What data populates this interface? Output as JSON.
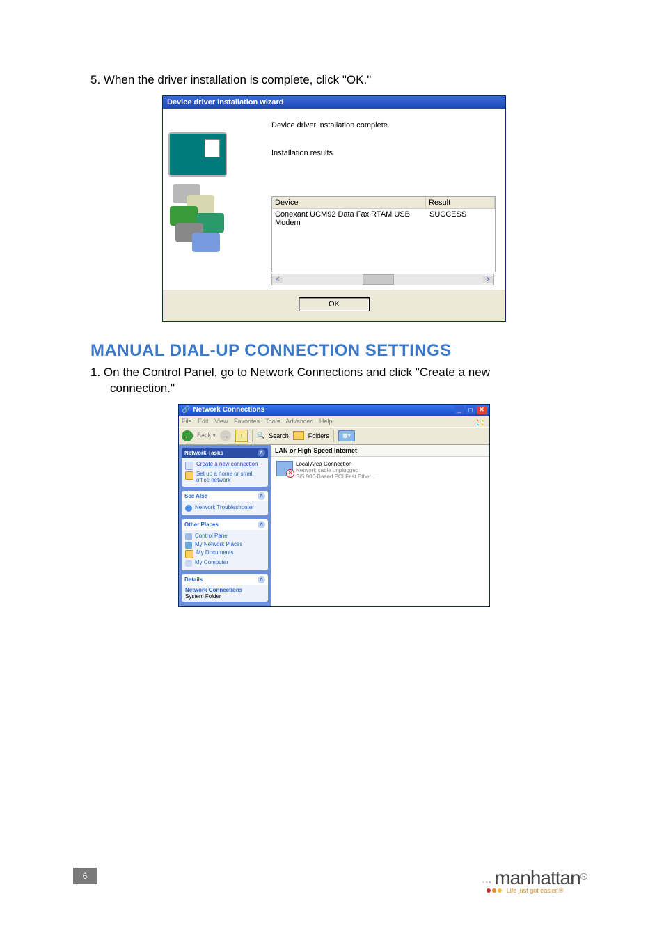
{
  "step5": {
    "num": "5.",
    "text": "When the driver installation is complete, click \"OK.\""
  },
  "wizard": {
    "title": "Device driver installation wizard",
    "line1": "Device driver installation complete.",
    "line2": "Installation results.",
    "col_device": "Device",
    "col_result": "Result",
    "row_device": "Conexant UCM92 Data Fax RTAM USB Modem",
    "row_result": "SUCCESS",
    "ok": "OK"
  },
  "section_heading": "MANUAL DIAL-UP CONNECTION SETTINGS",
  "step1": {
    "num": "1.",
    "text_a": "On the Control Panel, go to Network Connections and click \"Create a new",
    "text_b": "connection.\""
  },
  "xp": {
    "title": "Network Connections",
    "menu": {
      "file": "File",
      "edit": "Edit",
      "view": "View",
      "favorites": "Favorites",
      "tools": "Tools",
      "advanced": "Advanced",
      "help": "Help"
    },
    "toolbar": {
      "back": "Back",
      "search": "Search",
      "folders": "Folders"
    },
    "content_header": "LAN or High-Speed Internet",
    "lac": {
      "title": "Local Area Connection",
      "sub1": "Network cable unplugged",
      "sub2": "SiS 900-Based PCI Fast Ether..."
    },
    "tasks": {
      "network_tasks": {
        "header": "Network Tasks",
        "create": "Create a new connection",
        "setup": "Set up a home or small office network"
      },
      "see_also": {
        "header": "See Also",
        "troubleshooter": "Network Troubleshooter"
      },
      "other_places": {
        "header": "Other Places",
        "control_panel": "Control Panel",
        "my_network_places": "My Network Places",
        "my_documents": "My Documents",
        "my_computer": "My Computer"
      },
      "details": {
        "header": "Details",
        "title": "Network Connections",
        "sub": "System Folder"
      }
    }
  },
  "page_number": "6",
  "brand": {
    "name": "manhattan",
    "tagline": "Life just got easier.®"
  }
}
